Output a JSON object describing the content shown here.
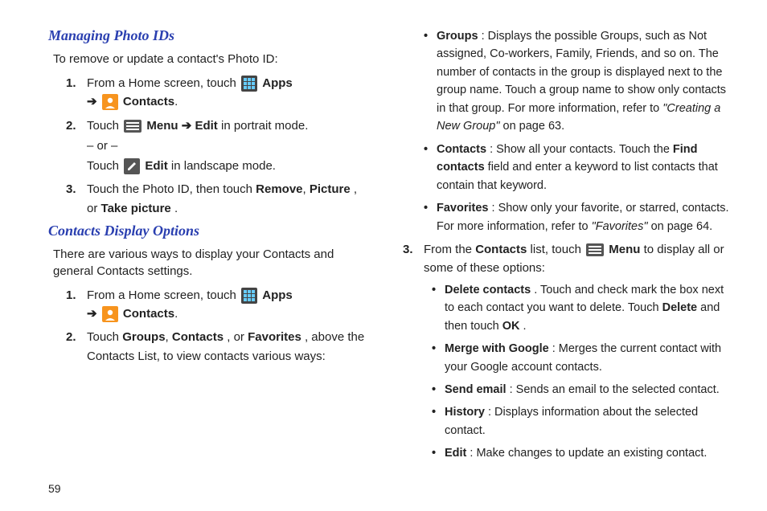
{
  "pageNumber": "59",
  "left": {
    "section1": {
      "heading": "Managing Photo IDs",
      "intro": "To remove or update a contact's Photo ID:",
      "steps": {
        "s1a": "From a Home screen, touch ",
        "s1_apps": "Apps",
        "s1_contacts": "Contacts",
        "s2a": "Touch ",
        "s2_menu": "Menu",
        "s2_edit": "Edit",
        "s2b": " in portrait mode.",
        "s2_or": "– or –",
        "s2c": "Touch ",
        "s2_edit2": "Edit",
        "s2d": " in landscape mode.",
        "s3a": "Touch the Photo ID, then touch ",
        "s3_remove": "Remove",
        "s3_picture": "Picture",
        "s3_or": ", or ",
        "s3_take": "Take picture",
        "s3_end": "."
      }
    },
    "section2": {
      "heading": "Contacts Display Options",
      "intro": "There are various ways to display your Contacts and general Contacts settings.",
      "steps": {
        "s1a": "From a Home screen, touch ",
        "s1_apps": "Apps",
        "s1_contacts": "Contacts",
        "s2a": "Touch ",
        "s2_groups": "Groups",
        "s2_contacts": "Contacts",
        "s2_or": ", or ",
        "s2_favorites": "Favorites",
        "s2b": ", above the Contacts List, to view contacts various ways:"
      }
    }
  },
  "right": {
    "bullets1": {
      "b1_groups": "Groups",
      "b1a": ": Displays the possible Groups, such as Not assigned, Co-workers, Family, Friends, and so on. The number of contacts in the group is displayed next to the group name. Touch a group name to show only contacts in that group. For more information, refer to ",
      "b1_ref": "\"Creating a New Group\"",
      "b1b": " on page 63.",
      "b2_contacts": "Contacts",
      "b2a": ": Show all your contacts. Touch the ",
      "b2_find": "Find contacts",
      "b2b": " field and enter a keyword to list contacts that contain that keyword.",
      "b3_fav": "Favorites",
      "b3a": ": Show only your favorite, or starred, contacts. For more information, refer to ",
      "b3_ref": "\"Favorites\"",
      "b3b": " on page 64."
    },
    "step3": {
      "a": "From the ",
      "contacts": "Contacts",
      "b": " list, touch ",
      "menu": "Menu",
      "c": " to display all or some of these options:"
    },
    "bullets2": {
      "b1_del": "Delete contacts",
      "b1a": ". Touch and check mark the box next to each contact you want to delete. Touch ",
      "b1_delete": "Delete",
      "b1b": " and then touch ",
      "b1_ok": "OK",
      "b1c": ".",
      "b2_merge": "Merge with Google",
      "b2a": ": Merges the current contact with your Google account contacts.",
      "b3_send": "Send email",
      "b3a": ": Sends an email to the selected contact.",
      "b4_hist": "History",
      "b4a": ": Displays information about the selected contact.",
      "b5_edit": "Edit",
      "b5a": ": Make changes to update an existing contact."
    }
  }
}
